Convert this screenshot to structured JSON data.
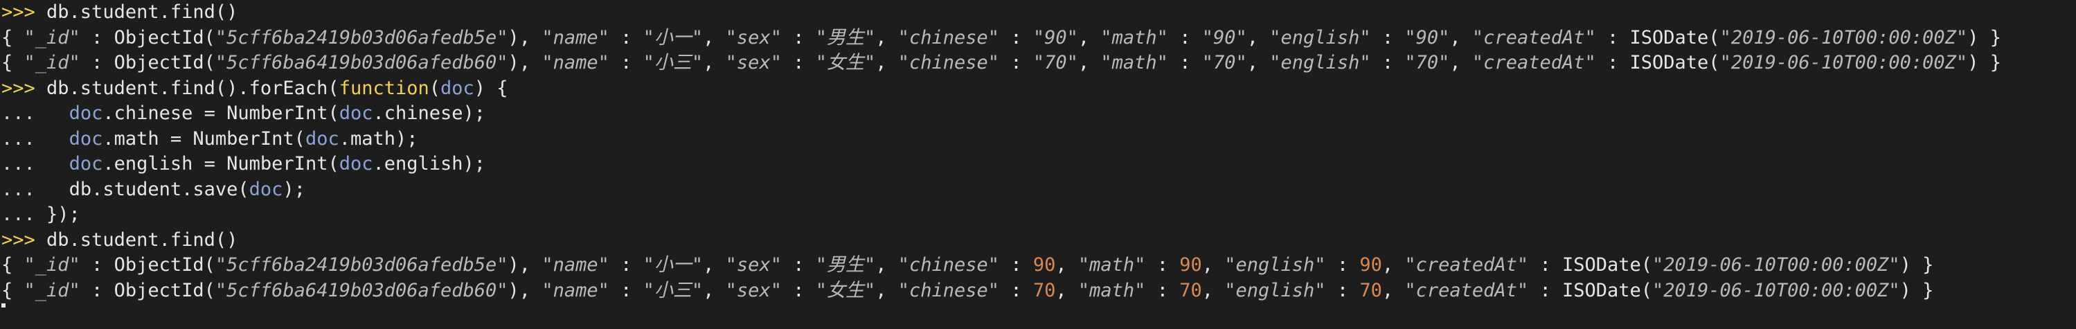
{
  "terminal": {
    "lines": [
      {
        "type": "cmd",
        "prompt": ">>>",
        "text": " db.student.find()"
      },
      {
        "type": "doc_str",
        "id": "5cff6ba2419b03d06afedb5e",
        "name": "小一",
        "sex": "男生",
        "chinese": "90",
        "math": "90",
        "english": "90",
        "createdAt": "2019-06-10T00:00:00Z"
      },
      {
        "type": "doc_str",
        "id": "5cff6ba6419b03d06afedb60",
        "name": "小三",
        "sex": "女生",
        "chinese": "70",
        "math": "70",
        "english": "70",
        "createdAt": "2019-06-10T00:00:00Z"
      },
      {
        "type": "foreach",
        "prompt": ">>>",
        "pre": " db.student.find().forEach(",
        "kw": "function",
        "open": "(",
        "arg": "doc",
        "post": ") {"
      },
      {
        "type": "assign",
        "prompt": "...",
        "indent": "   ",
        "var": "doc",
        "mid": ".chinese = NumberInt(",
        "var2": "doc",
        "end": ".chinese);"
      },
      {
        "type": "assign",
        "prompt": "...",
        "indent": "   ",
        "var": "doc",
        "mid": ".math = NumberInt(",
        "var2": "doc",
        "end": ".math);"
      },
      {
        "type": "assign",
        "prompt": "...",
        "indent": "   ",
        "var": "doc",
        "mid": ".english = NumberInt(",
        "var2": "doc",
        "end": ".english);"
      },
      {
        "type": "save",
        "prompt": "...",
        "indent": "   ",
        "pre": "db.student.save(",
        "var": "doc",
        "end": ");"
      },
      {
        "type": "close",
        "prompt": "...",
        "text": " });"
      },
      {
        "type": "cmd",
        "prompt": ">>>",
        "text": " db.student.find()"
      },
      {
        "type": "doc_num",
        "id": "5cff6ba2419b03d06afedb5e",
        "name": "小一",
        "sex": "男生",
        "chinese": "90",
        "math": "90",
        "english": "90",
        "createdAt": "2019-06-10T00:00:00Z"
      },
      {
        "type": "doc_num",
        "id": "5cff6ba6419b03d06afedb60",
        "name": "小三",
        "sex": "女生",
        "chinese": "70",
        "math": "70",
        "english": "70",
        "createdAt": "2019-06-10T00:00:00Z"
      },
      {
        "type": "stub"
      }
    ],
    "tokens": {
      "open_brace": "{ ",
      "close_brace": " }",
      "id_key": "\"_id\"",
      "objectid_fn": "ObjectId(",
      "isodate_fn": "ISODate(",
      "close_paren": ")",
      "sep": " : ",
      "comma": ", ",
      "name_key": "\"name\"",
      "sex_key": "\"sex\"",
      "chinese_key": "\"chinese\"",
      "math_key": "\"math\"",
      "english_key": "\"english\"",
      "createdAt_key": "\"createdAt\""
    }
  },
  "colors": {
    "background": "#1d1d1d",
    "prompt": "#f2d24b",
    "number": "#d9894f",
    "variable": "#8aa4d6",
    "string": "#b9b9b9"
  }
}
